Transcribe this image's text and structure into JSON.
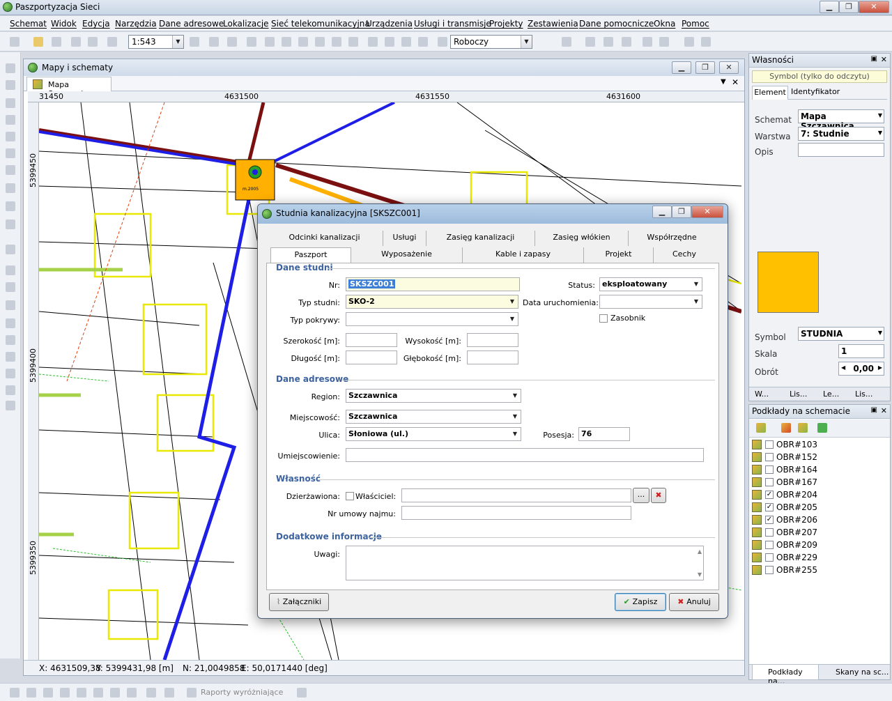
{
  "app": {
    "title": "Paszportyzacja Sieci",
    "menu": [
      "Schemat",
      "Widok",
      "Edycja",
      "Narzędzia",
      "Dane adresowe",
      "Lokalizacje",
      "Sieć telekomunikacyjna",
      "Urządzenia",
      "Usługi i transmisje",
      "Projekty",
      "Zestawienia",
      "Dane pomocnicze",
      "Okna",
      "Pomoc"
    ],
    "scale": "1:543",
    "mode": "Roboczy"
  },
  "map_window": {
    "title": "Mapy i schematy",
    "tab": "Mapa Szczawnica",
    "ruler_x": [
      "31450",
      "4631500",
      "4631550",
      "4631600"
    ],
    "ruler_y": [
      "5399450",
      "5399400",
      "5399350"
    ],
    "symbol_label": "m.2005"
  },
  "status": {
    "x": "X: 4631509,38",
    "y": "Y: 5399431,98 [m]",
    "n": "N: 21,0049858",
    "e": "E: 50,0171440 [deg]"
  },
  "bottombar": {
    "reports": "Raporty wyróżniające"
  },
  "properties": {
    "title": "Własności",
    "readonly": "Symbol (tylko do odczytu)",
    "tabs": [
      "Element",
      "Identyfikator"
    ],
    "schemat_label": "Schemat",
    "schemat": "Mapa Szczawnica",
    "warstwa_label": "Warstwa",
    "warstwa": "7: Studnie",
    "opis_label": "Opis",
    "symbol_label": "Symbol",
    "symbol": "STUDNIA",
    "skala_label": "Skala",
    "skala": "1",
    "obrot_label": "Obrót",
    "obrot": "0,00",
    "bottom_tabs": [
      "W...",
      "Lis...",
      "Le...",
      "Lis..."
    ],
    "swatch_color": "#ffc000"
  },
  "layers": {
    "title": "Podkłady na schemacie",
    "items": [
      {
        "name": "OBR#103",
        "checked": false
      },
      {
        "name": "OBR#152",
        "checked": false
      },
      {
        "name": "OBR#164",
        "checked": false
      },
      {
        "name": "OBR#167",
        "checked": false
      },
      {
        "name": "OBR#204",
        "checked": true
      },
      {
        "name": "OBR#205",
        "checked": true
      },
      {
        "name": "OBR#206",
        "checked": true
      },
      {
        "name": "OBR#207",
        "checked": false
      },
      {
        "name": "OBR#209",
        "checked": false
      },
      {
        "name": "OBR#229",
        "checked": false
      },
      {
        "name": "OBR#255",
        "checked": false
      }
    ],
    "bottom_tabs": [
      "Podkłady na...",
      "Skany na sc..."
    ]
  },
  "dialog": {
    "title": "Studnia kanalizacyjna [SKSZC001]",
    "tabs_row1": [
      "Odcinki kanalizacji",
      "Usługi",
      "Zasięg kanalizacji",
      "Zasięg włókien",
      "Współrzędne"
    ],
    "tabs_row2": [
      "Paszport",
      "Wyposażenie",
      "Kable i zapasy",
      "Projekt",
      "Cechy"
    ],
    "sections": {
      "studnia": "Dane studni",
      "adres": "Dane adresowe",
      "wlasnosc": "Własność",
      "dodatkowe": "Dodatkowe informacje"
    },
    "labels": {
      "nr": "Nr:",
      "typ_studni": "Typ studni:",
      "typ_pokrywy": "Typ pokrywy:",
      "szerokosc": "Szerokość [m]:",
      "dlugosc": "Długość [m]:",
      "wysokosc": "Wysokość [m]:",
      "glebokosc": "Głębokość [m]:",
      "status": "Status:",
      "data_uruch": "Data uruchomienia:",
      "zasobnik": "Zasobnik",
      "region": "Region:",
      "miejscowosc": "Miejscowość:",
      "ulica": "Ulica:",
      "posesja": "Posesja:",
      "umiejscowienie": "Umiejscowienie:",
      "dzierzawiona": "Dzierżawiona:",
      "wlasciciel": "Właściciel:",
      "nr_umowy": "Nr umowy najmu:",
      "uwagi": "Uwagi:"
    },
    "values": {
      "nr": "SKSZC001",
      "typ_studni": "SKO-2",
      "typ_pokrywy": "",
      "status": "eksploatowany",
      "data_uruch": "",
      "region": "Szczawnica",
      "miejscowosc": "Szczawnica",
      "ulica": "Słoniowa (ul.)",
      "posesja": "76"
    },
    "buttons": {
      "zalaczniki": "Załączniki",
      "zapisz": "Zapisz",
      "anuluj": "Anuluj",
      "browse": "..."
    }
  }
}
